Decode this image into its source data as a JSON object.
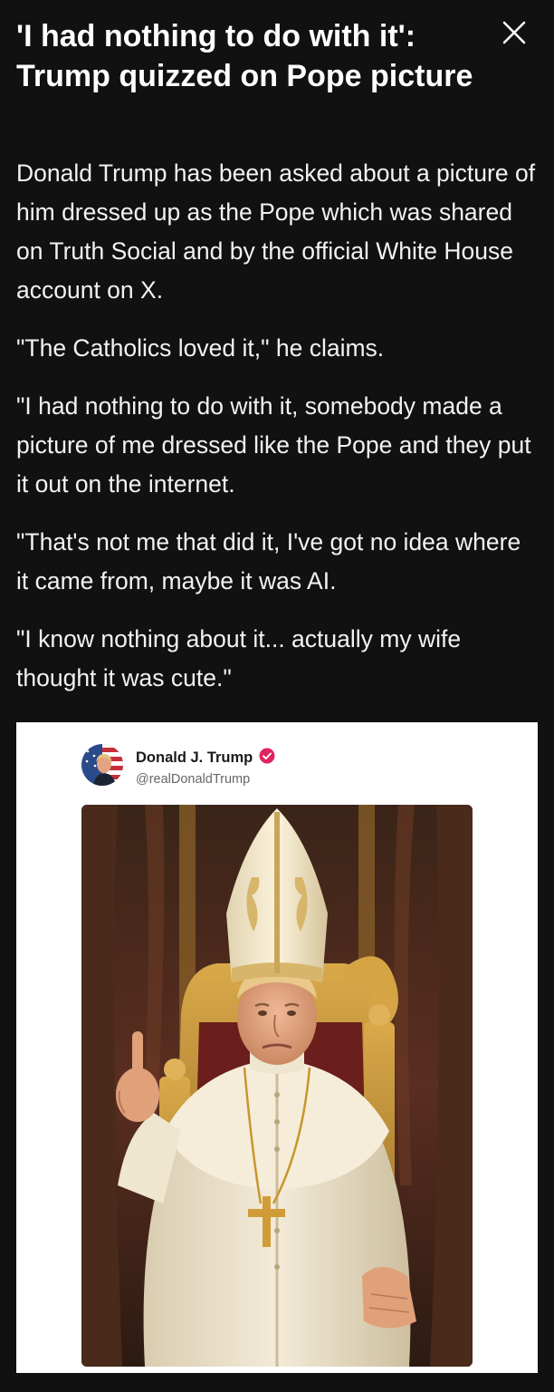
{
  "headline": "'I had nothing to do with it': Trump quizzed on Pope picture",
  "close_icon": "close-icon",
  "paragraphs": [
    "Donald Trump has been asked about a picture of him dressed up as the Pope which was shared on Truth Social and by the official White House account on X.",
    "\"The Catholics loved it,\" he claims.",
    "\"I had nothing to do with it, somebody made a picture of me dressed like the Pope and they put it out on the internet.",
    "\"That's not me that did it, I've got no idea where it came from, maybe it was AI.",
    "\"I know nothing about it... actually my wife thought it was cute.\""
  ],
  "embed": {
    "author_name": "Donald J. Trump",
    "handle": "@realDonaldTrump",
    "verified_icon": "verified-badge-icon",
    "verified_color": "#e0245e",
    "image_subject": "pope-portrait-image"
  },
  "colors": {
    "background": "#111111",
    "text": "#ffffff",
    "embed_background": "#ffffff"
  }
}
